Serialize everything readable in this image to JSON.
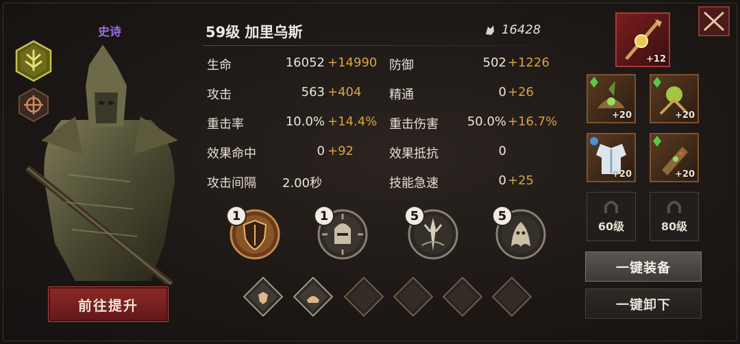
{
  "hero": {
    "rarity": "史诗",
    "level_name": "59级  加里乌斯",
    "power": "16428"
  },
  "stats": [
    {
      "label": "生命",
      "base": "16052",
      "bonus": "+14990"
    },
    {
      "label": "防御",
      "base": "502",
      "bonus": "+1226"
    },
    {
      "label": "攻击",
      "base": "563",
      "bonus": "+404"
    },
    {
      "label": "精通",
      "base": "0",
      "bonus": "+26"
    },
    {
      "label": "重击率",
      "base": "10.0%",
      "bonus": "+14.4%"
    },
    {
      "label": "重击伤害",
      "base": "50.0%",
      "bonus": "+16.7%"
    },
    {
      "label": "效果命中",
      "base": "0",
      "bonus": "+92"
    },
    {
      "label": "效果抵抗",
      "base": "0",
      "bonus": ""
    },
    {
      "label": "攻击间隔",
      "base": "2.00秒",
      "bonus": ""
    },
    {
      "label": "技能急速",
      "base": "0",
      "bonus": "+25"
    }
  ],
  "skills": [
    {
      "level": "1",
      "icon": "shield-skill-icon"
    },
    {
      "level": "1",
      "icon": "helm-skill-icon"
    },
    {
      "level": "5",
      "icon": "spear-skill-icon"
    },
    {
      "level": "5",
      "icon": "spirit-skill-icon"
    }
  ],
  "equipment": {
    "weapon_level": "+12",
    "slots": [
      {
        "level": "+20",
        "icon": "hat-icon"
      },
      {
        "level": "+20",
        "icon": "amulet-icon"
      },
      {
        "level": "+20",
        "icon": "armor-icon"
      },
      {
        "level": "+20",
        "icon": "bracer-icon"
      }
    ],
    "locked": [
      "60级",
      "80级"
    ]
  },
  "buttons": {
    "upgrade": "前往提升",
    "equip_all": "一键装备",
    "unequip_all": "一键卸下"
  },
  "colors": {
    "accent_gold": "#d9a441",
    "rarity_purple": "#9a6be0",
    "upgrade_red": "#8c2a26"
  }
}
